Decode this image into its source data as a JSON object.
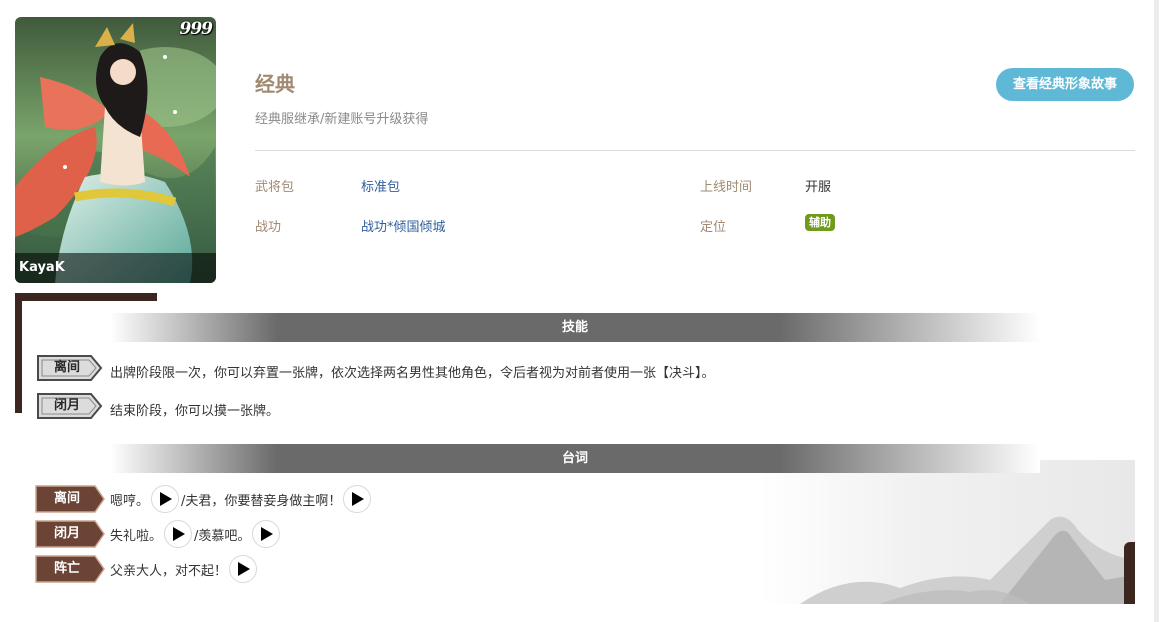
{
  "card": {
    "rarity": "999",
    "artist": "KayaK"
  },
  "skin": {
    "name": "经典",
    "subtitle": "经典服继承/新建账号升级获得",
    "story_button": "查看经典形象故事"
  },
  "info": {
    "pack_label": "武将包",
    "pack_value": "标准包",
    "release_label": "上线时间",
    "release_value": "开服",
    "merit_label": "战功",
    "merit_value": "战功*倾国倾城",
    "role_label": "定位",
    "role_value": "辅助"
  },
  "skills": {
    "header": "技能",
    "items": [
      {
        "name": "离间",
        "desc": "出牌阶段限一次，你可以弃置一张牌，依次选择两名男性其他角色，令后者视为对前者使用一张【决斗】。"
      },
      {
        "name": "闭月",
        "desc": "结束阶段，你可以摸一张牌。"
      }
    ]
  },
  "lines": {
    "header": "台词",
    "items": [
      {
        "name": "离间",
        "text1": "嗯哼。",
        "text2": "/夫君，你要替妾身做主啊！"
      },
      {
        "name": "闭月",
        "text1": "失礼啦。",
        "text2": "/羡慕吧。"
      },
      {
        "name": "阵亡",
        "text1": "父亲大人，对不起！"
      }
    ]
  },
  "icons": {
    "play": "play-icon"
  },
  "colors": {
    "accent_button": "#5fb9d6",
    "role_badge": "#6f9a1e",
    "label": "#a08a72",
    "link": "#2f5f9c"
  }
}
